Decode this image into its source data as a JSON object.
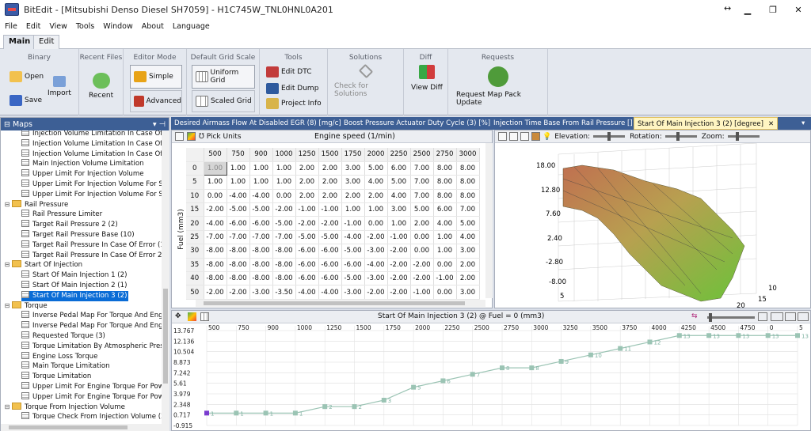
{
  "window": {
    "title": "BitEdit - [Mitsubishi Denso Diesel SH7059] - H1C745W_TNL0HNL0A201",
    "resize": "↔",
    "min": "▁",
    "max": "❐",
    "close": "✕"
  },
  "menu": [
    "File",
    "Edit",
    "View",
    "Tools",
    "Window",
    "About",
    "Language"
  ],
  "ribbon_tabs": [
    "Main",
    "Edit"
  ],
  "ribbon": {
    "binary": {
      "title": "Binary",
      "open": "Open",
      "import": "Import",
      "save": "Save"
    },
    "recent": {
      "title": "Recent Files",
      "recent": "Recent"
    },
    "editor": {
      "title": "Editor Mode",
      "simple": "Simple",
      "advanced": "Advanced"
    },
    "grid": {
      "title": "Default Grid Scale",
      "uniform": "Uniform Grid",
      "scaled": "Scaled Grid"
    },
    "tools": {
      "title": "Tools",
      "dtc": "Edit DTC",
      "dump": "Edit Dump",
      "project": "Project Info"
    },
    "solutions": {
      "title": "Solutions",
      "check": "Check for Solutions"
    },
    "diff": {
      "title": "Diff",
      "view": "View Diff"
    },
    "requests": {
      "title": "Requests",
      "update": "Request Map Pack Update"
    }
  },
  "maps_panel": {
    "title": "Maps",
    "pin": "▾ ⊣"
  },
  "tree": [
    {
      "label": "Injection Volume Limitation In Case Of S",
      "type": "map",
      "indent": 2
    },
    {
      "label": "Injection Volume Limitation In Case Of S",
      "type": "map",
      "indent": 2
    },
    {
      "label": "Injection Volume Limitation In Case Of S",
      "type": "map",
      "indent": 2
    },
    {
      "label": "Main Injection Volume Limitation",
      "type": "map",
      "indent": 2
    },
    {
      "label": "Upper Limit For Injection Volume",
      "type": "map",
      "indent": 2
    },
    {
      "label": "Upper Limit For Injection Volume For Sy",
      "type": "map",
      "indent": 2
    },
    {
      "label": "Upper Limit For Injection Volume For Sy",
      "type": "map",
      "indent": 2
    },
    {
      "label": "Rail Pressure",
      "type": "folder",
      "indent": 0
    },
    {
      "label": "Rail Pressure Limiter",
      "type": "map",
      "indent": 2
    },
    {
      "label": "Target Rail Pressure 2 (2)",
      "type": "map",
      "indent": 2
    },
    {
      "label": "Target Rail Pressure Base (10)",
      "type": "map",
      "indent": 2
    },
    {
      "label": "Target Rail Pressure In Case Of Error (1)",
      "type": "map",
      "indent": 2
    },
    {
      "label": "Target Rail Pressure In Case Of Error 2",
      "type": "map",
      "indent": 2
    },
    {
      "label": "Start Of Injection",
      "type": "folder",
      "indent": 0
    },
    {
      "label": "Start Of Main Injection 1 (2)",
      "type": "map",
      "indent": 2
    },
    {
      "label": "Start Of Main Injection 2 (1)",
      "type": "map",
      "indent": 2
    },
    {
      "label": "Start Of Main Injection 3 (2)",
      "type": "map",
      "indent": 2,
      "selected": true
    },
    {
      "label": "Torque",
      "type": "folder",
      "indent": 0
    },
    {
      "label": "Inverse Pedal Map For Torque And Engi",
      "type": "map",
      "indent": 2
    },
    {
      "label": "Inverse Pedal Map For Torque And Engi",
      "type": "map",
      "indent": 2
    },
    {
      "label": "Requested Torque (3)",
      "type": "map",
      "indent": 2
    },
    {
      "label": "Torque Limitation By Atmospheric Press",
      "type": "map",
      "indent": 2
    },
    {
      "label": "Engine Loss Torque",
      "type": "map",
      "indent": 2
    },
    {
      "label": "Main Torque Limitation",
      "type": "map",
      "indent": 2
    },
    {
      "label": "Torque Limitation",
      "type": "map",
      "indent": 2
    },
    {
      "label": "Upper Limit For Engine Torque For Powe",
      "type": "map",
      "indent": 2
    },
    {
      "label": "Upper Limit For Engine Torque For Powe",
      "type": "map",
      "indent": 2
    },
    {
      "label": "Torque From Injection Volume",
      "type": "folder",
      "indent": 0
    },
    {
      "label": "Torque Check From Injection Volume (2",
      "type": "map",
      "indent": 2
    }
  ],
  "doc_tabs": [
    "Desired Airmass Flow At Disabled EGR (8) [mg/c]",
    "Boost Pressure Actuator Duty Cycle (3) [%]",
    "Injection Time Base From Rail Pressure []",
    "Start Of Main Injection 3 (2) [degree]"
  ],
  "grid": {
    "pick_units": "Pick Units",
    "x_axis_label": "Engine speed (1/min)",
    "y_axis_label": "Fuel (mm3)",
    "cols": [
      "500",
      "750",
      "900",
      "1000",
      "1250",
      "1500",
      "1750",
      "2000",
      "2250",
      "2500",
      "2750",
      "3000"
    ],
    "rows": [
      {
        "h": "0",
        "v": [
          "1.00",
          "1.00",
          "1.00",
          "1.00",
          "2.00",
          "2.00",
          "3.00",
          "5.00",
          "6.00",
          "7.00",
          "8.00",
          "8.00"
        ]
      },
      {
        "h": "5",
        "v": [
          "1.00",
          "1.00",
          "1.00",
          "1.00",
          "2.00",
          "2.00",
          "3.00",
          "4.00",
          "5.00",
          "7.00",
          "8.00",
          "8.00"
        ]
      },
      {
        "h": "10",
        "v": [
          "0.00",
          "-4.00",
          "-4.00",
          "0.00",
          "2.00",
          "2.00",
          "2.00",
          "2.00",
          "4.00",
          "7.00",
          "8.00",
          "8.00"
        ]
      },
      {
        "h": "15",
        "v": [
          "-2.00",
          "-5.00",
          "-5.00",
          "-2.00",
          "-1.00",
          "-1.00",
          "1.00",
          "1.00",
          "3.00",
          "5.00",
          "6.00",
          "7.00"
        ]
      },
      {
        "h": "20",
        "v": [
          "-4.00",
          "-6.00",
          "-6.00",
          "-5.00",
          "-2.00",
          "-2.00",
          "-1.00",
          "0.00",
          "1.00",
          "2.00",
          "4.00",
          "5.00"
        ]
      },
      {
        "h": "25",
        "v": [
          "-7.00",
          "-7.00",
          "-7.00",
          "-7.00",
          "-5.00",
          "-5.00",
          "-4.00",
          "-2.00",
          "-1.00",
          "0.00",
          "1.00",
          "4.00"
        ]
      },
      {
        "h": "30",
        "v": [
          "-8.00",
          "-8.00",
          "-8.00",
          "-8.00",
          "-6.00",
          "-6.00",
          "-5.00",
          "-3.00",
          "-2.00",
          "0.00",
          "1.00",
          "3.00"
        ]
      },
      {
        "h": "35",
        "v": [
          "-8.00",
          "-8.00",
          "-8.00",
          "-8.00",
          "-6.00",
          "-6.00",
          "-6.00",
          "-4.00",
          "-2.00",
          "-2.00",
          "0.00",
          "2.00"
        ]
      },
      {
        "h": "40",
        "v": [
          "-8.00",
          "-8.00",
          "-8.00",
          "-8.00",
          "-6.00",
          "-6.00",
          "-5.00",
          "-3.00",
          "-2.00",
          "-2.00",
          "-1.00",
          "2.00"
        ]
      },
      {
        "h": "50",
        "v": [
          "-2.00",
          "-2.00",
          "-3.00",
          "-3.50",
          "-4.00",
          "-4.00",
          "-3.00",
          "-2.00",
          "-2.00",
          "-1.00",
          "0.00",
          "3.00"
        ]
      }
    ]
  },
  "chart3d": {
    "elevation": "Elevation:",
    "rotation": "Rotation:",
    "zoom": "Zoom:",
    "z_ticks": [
      "18.00",
      "12.80",
      "7.60",
      "2.40",
      "-2.80",
      "-8.00"
    ],
    "side_ticks": [
      "5",
      "10",
      "15",
      "20"
    ]
  },
  "chart_data": {
    "type": "line",
    "title": "Start Of Main Injection 3 (2) @ Fuel = 0 (mm3)",
    "x": [
      "500",
      "750",
      "900",
      "1000",
      "1250",
      "1500",
      "1750",
      "2000",
      "2250",
      "2500",
      "2750",
      "3000",
      "3250",
      "3500",
      "3750",
      "4000",
      "4250",
      "4500",
      "4750",
      "0",
      "5"
    ],
    "values": [
      1,
      1,
      1,
      1,
      2,
      2,
      3,
      5,
      6,
      7,
      8,
      8,
      9,
      10,
      11,
      12,
      13,
      13,
      13,
      13,
      13
    ],
    "yticks": [
      "13.767",
      "12.136",
      "10.504",
      "8.873",
      "7.242",
      "5.61",
      "3.979",
      "2.348",
      "0.717",
      "-0.915"
    ],
    "ylim": [
      -0.915,
      13.767
    ],
    "color": "#9bc4b4"
  }
}
